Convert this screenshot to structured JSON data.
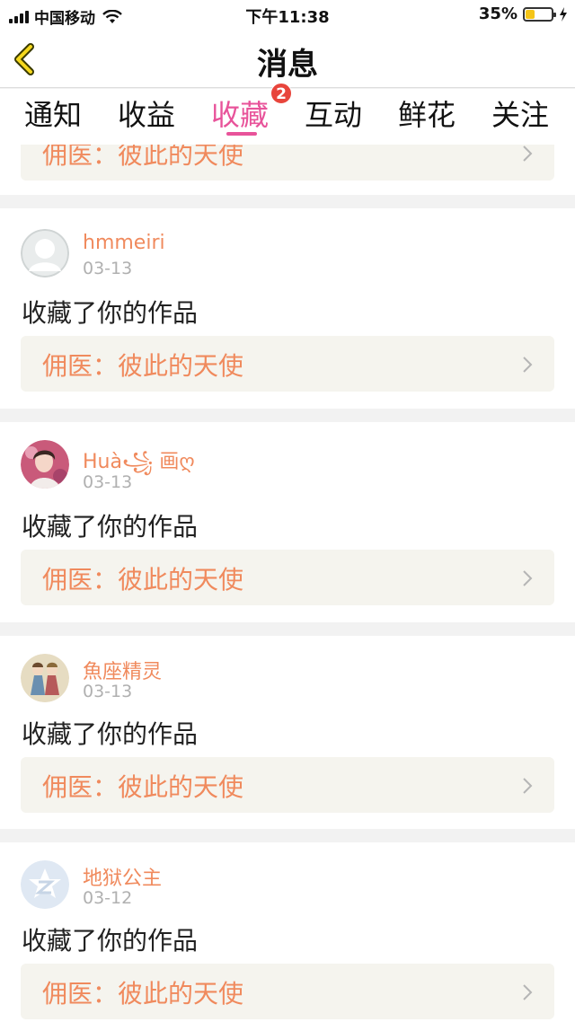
{
  "status_bar": {
    "carrier": "中国移动",
    "time": "下午11:38",
    "battery_percent": "35%",
    "battery_level": 0.35,
    "battery_color": "#f5c518"
  },
  "nav": {
    "title": "消息",
    "back_icon": "chevron-left-icon",
    "back_icon_color": "#f5c518"
  },
  "tabs": {
    "items": [
      {
        "label": "通知"
      },
      {
        "label": "收益"
      },
      {
        "label": "收藏",
        "active": true,
        "badge": "2"
      },
      {
        "label": "互动"
      },
      {
        "label": "鲜花"
      },
      {
        "label": "关注"
      }
    ],
    "active_color": "#e8539a"
  },
  "feed": {
    "partial_item": {
      "work_title": "佣医：彼此的天使"
    },
    "items": [
      {
        "username": "hmmeiri",
        "date": "03-13",
        "action": "收藏了你的作品",
        "work_title": "佣医：彼此的天使",
        "avatar": "default-avatar-icon"
      },
      {
        "username": "Huà꧁ 画ღ",
        "date": "03-13",
        "action": "收藏了你的作品",
        "work_title": "佣医：彼此的天使",
        "avatar": "photo-avatar"
      },
      {
        "username": "魚座精灵",
        "date": "03-13",
        "action": "收藏了你的作品",
        "work_title": "佣医：彼此的天使",
        "avatar": "illustration-avatar"
      },
      {
        "username": "地狱公主",
        "date": "03-12",
        "action": "收藏了你的作品",
        "work_title": "佣医：彼此的天使",
        "avatar": "qzone-avatar-icon"
      }
    ]
  },
  "colors": {
    "accent_orange": "#f08a5d",
    "work_box_bg": "#f5f4ee",
    "badge_red": "#e8453c"
  }
}
